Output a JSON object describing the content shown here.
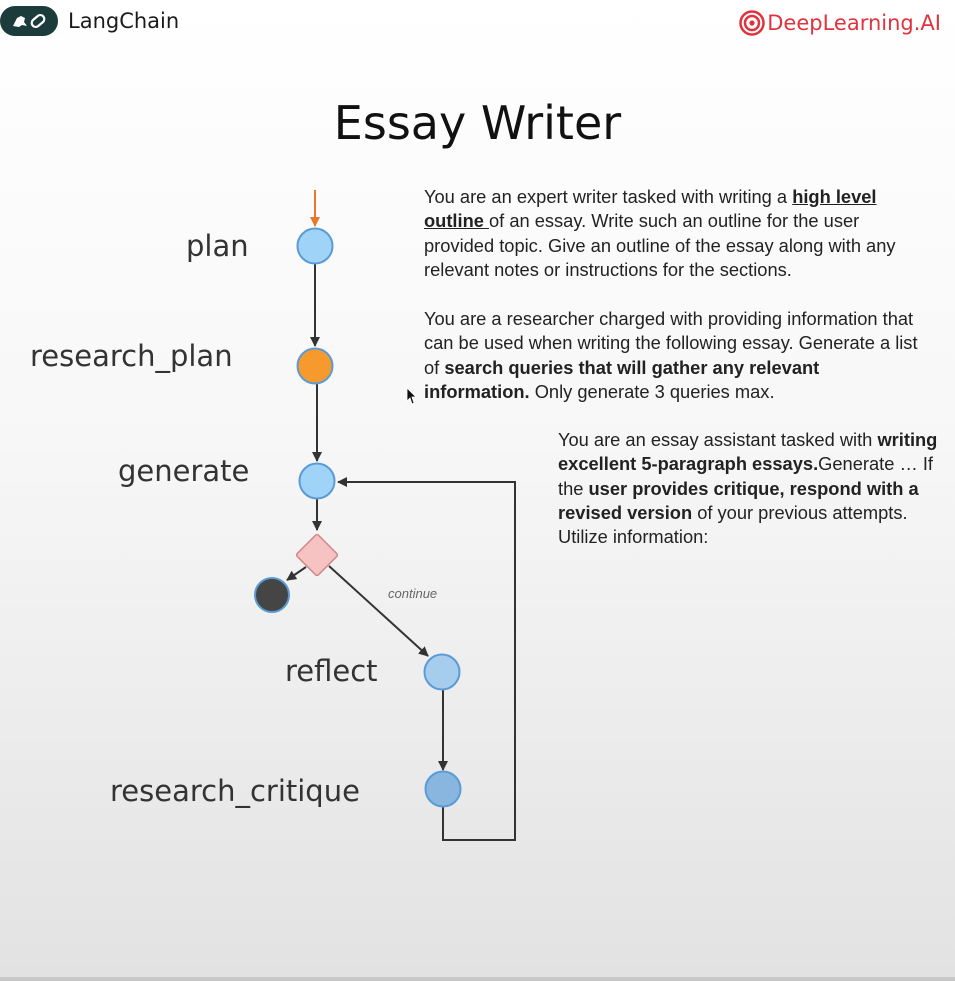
{
  "header": {
    "langchain_label": "LangChain",
    "deeplearning_label": "DeepLearning.AI"
  },
  "title": "Essay Writer",
  "nodes": {
    "plan": "plan",
    "research_plan": "research_plan",
    "generate": "generate",
    "reflect": "reflect",
    "research_critique": "research_critique"
  },
  "edges": {
    "continue_label": "continue"
  },
  "prompts": {
    "plan": {
      "t1": "You are an expert writer tasked with writing a ",
      "b1": "high level outline ",
      "t2": "of an essay. Write such an outline for the user provided topic. Give an outline of the essay along with any relevant notes or instructions for the sections."
    },
    "research_plan": {
      "t1": "You are a researcher charged with providing information that can be used when writing the following essay. Generate a list of ",
      "b1": "search queries that will gather any relevant information.",
      "t2": " Only generate 3 queries max."
    },
    "generate": {
      "t1": "You are an essay assistant tasked with ",
      "b1": "writing excellent 5-paragraph essays.",
      "t2": "Generate … If the ",
      "b2": "user provides critique, respond with a revised version",
      "t3": " of your previous attempts. Utilize information:"
    }
  },
  "colors": {
    "node_blue": "#9fd3f7",
    "node_orange": "#f79a2e",
    "node_reflect": "#a7cdee",
    "node_critique": "#89b6df",
    "end_node": "#454545",
    "decision": "#f6c2c2",
    "entry_arrow": "#e57a2c",
    "brand_red": "#e0333e",
    "brand_dark": "#1c3c3c"
  }
}
